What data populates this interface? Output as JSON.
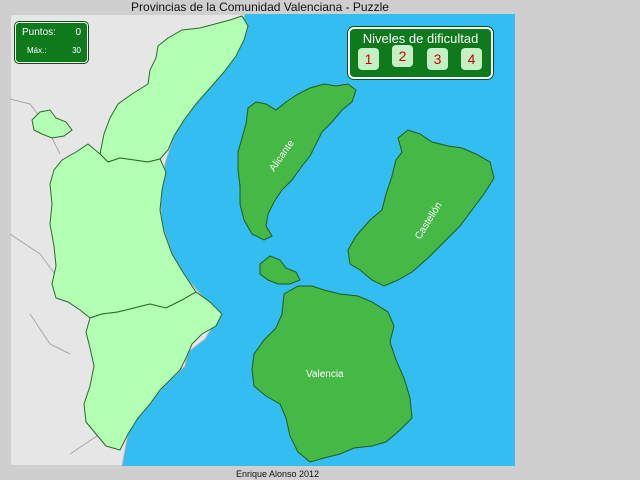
{
  "title": "Provincias de la Comunidad Valenciana - Puzzle",
  "footer": "Enrique Alonso 2012",
  "score": {
    "points_label": "Puntos:",
    "points_value": "0",
    "max_label": "Máx.:",
    "max_value": "30"
  },
  "levels": {
    "title": "Niveles de dificultad",
    "buttons": [
      "1",
      "2",
      "3",
      "4"
    ]
  },
  "pieces": {
    "alicante": "Alicante",
    "castellon": "Castellón",
    "valencia": "Valencia"
  },
  "colors": {
    "sea": "#33bdf0",
    "land_other": "#e6e6e6",
    "placed": "#b3ffb3",
    "piece": "#45b845",
    "panel": "#0e7a1b"
  }
}
